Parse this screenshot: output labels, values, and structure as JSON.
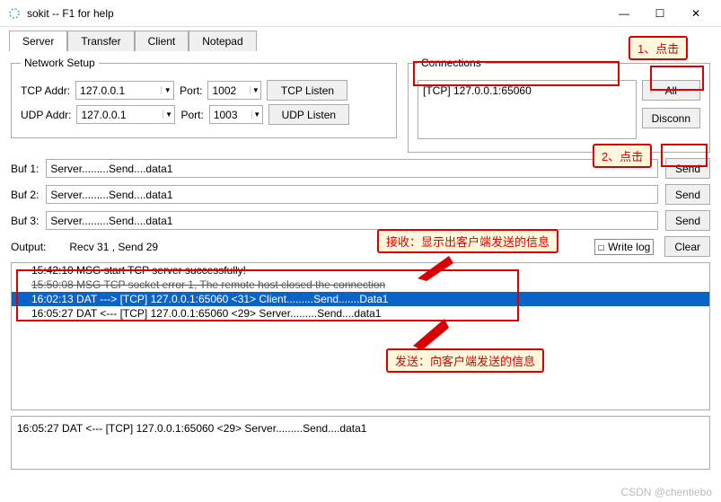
{
  "window": {
    "title": "sokit -- F1 for help",
    "min": "—",
    "max": "☐",
    "close": "✕"
  },
  "tabs": [
    "Server",
    "Transfer",
    "Client",
    "Notepad"
  ],
  "network_setup": {
    "legend": "Network Setup",
    "tcp_label": "TCP Addr:",
    "tcp_addr": "127.0.0.1",
    "tcp_port_label": "Port:",
    "tcp_port": "1002",
    "tcp_btn": "TCP Listen",
    "udp_label": "UDP Addr:",
    "udp_addr": "127.0.0.1",
    "udp_port_label": "Port:",
    "udp_port": "1003",
    "udp_btn": "UDP Listen"
  },
  "connections": {
    "legend": "Connections",
    "item": "[TCP] 127.0.0.1:65060",
    "all_btn": "All",
    "disconn_btn": "Disconn"
  },
  "bufs": {
    "label1": "Buf 1:",
    "val1": "Server.........Send....data1",
    "btn": "Send",
    "label2": "Buf 2:",
    "val2": "Server.........Send....data1",
    "label3": "Buf 3:",
    "val3": "Server.........Send....data1"
  },
  "output": {
    "label": "Output:",
    "stats": "Recv 31 ,  Send 29",
    "writelog": "Write log",
    "clear_btn": "Clear",
    "lines": [
      "15:42:10 MSG start TCP server successfully!",
      "15:50:08 MSG TCP socket error 1, The remote host closed the connection",
      "16:02:13 DAT ---> [TCP] 127.0.0.1:65060 <31> Client.........Send.......Data1",
      "16:05:27 DAT <--- [TCP] 127.0.0.1:65060 <29> Server.........Send....data1"
    ]
  },
  "bottom": "16:05:27 DAT <--- [TCP] 127.0.0.1:65060 <29> Server.........Send....data1",
  "annotations": {
    "a1": "1、点击",
    "a2": "2、点击",
    "a3": "接收：显示出客户端发送的信息",
    "a4": "发送：向客户端发送的信息"
  },
  "watermark": "CSDN @chentiebo"
}
